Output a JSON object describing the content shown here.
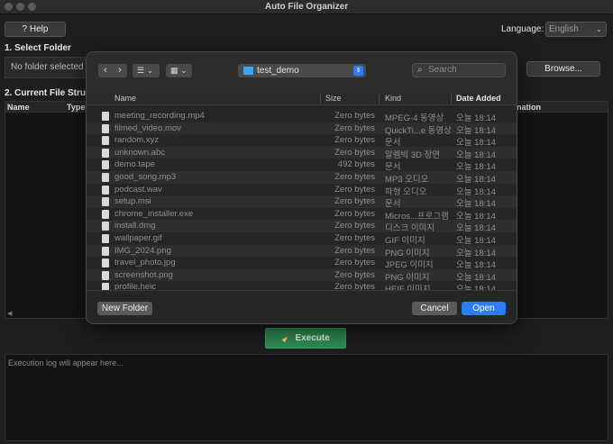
{
  "window": {
    "title": "Auto File Organizer"
  },
  "toolbar": {
    "help_label": "? Help",
    "language_label": "Language:",
    "language_value": "English"
  },
  "section1": {
    "title": "1. Select Folder",
    "folder_placeholder": "No folder selected",
    "browse_label": "Browse..."
  },
  "section2": {
    "title": "2. Current File Structu",
    "columns": [
      "Name",
      "Type",
      "nation"
    ]
  },
  "execute": {
    "label": "Execute"
  },
  "log": {
    "placeholder": "Execution log will appear here..."
  },
  "dialog": {
    "current_folder": "test_demo",
    "search_placeholder": "Search",
    "columns": {
      "name": "Name",
      "size": "Size",
      "kind": "Kind",
      "date": "Date Added"
    },
    "files": [
      {
        "name": "meeting_recording.mp4",
        "size": "Zero bytes",
        "kind": "MPEG-4 동영상",
        "date": "오늘 18:14"
      },
      {
        "name": "filmed_video.mov",
        "size": "Zero bytes",
        "kind": "QuickTi...e 동영상",
        "date": "오늘 18:14"
      },
      {
        "name": "random.xyz",
        "size": "Zero bytes",
        "kind": "문서",
        "date": "오늘 18:14"
      },
      {
        "name": "unknown.abc",
        "size": "Zero bytes",
        "kind": "알렘빅 3D 장면",
        "date": "오늘 18:14"
      },
      {
        "name": "demo.tape",
        "size": "492 bytes",
        "kind": "문서",
        "date": "오늘 18:14"
      },
      {
        "name": "good_song.mp3",
        "size": "Zero bytes",
        "kind": "MP3 오디오",
        "date": "오늘 18:14"
      },
      {
        "name": "podcast.wav",
        "size": "Zero bytes",
        "kind": "파형 오디오",
        "date": "오늘 18:14"
      },
      {
        "name": "setup.msi",
        "size": "Zero bytes",
        "kind": "문서",
        "date": "오늘 18:14"
      },
      {
        "name": "chrome_installer.exe",
        "size": "Zero bytes",
        "kind": "Micros...프로그램",
        "date": "오늘 18:14"
      },
      {
        "name": "install.dmg",
        "size": "Zero bytes",
        "kind": "디스크 이미지",
        "date": "오늘 18:14"
      },
      {
        "name": "wallpaper.gif",
        "size": "Zero bytes",
        "kind": "GIF 이미지",
        "date": "오늘 18:14"
      },
      {
        "name": "IMG_2024.png",
        "size": "Zero bytes",
        "kind": "PNG 이미지",
        "date": "오늘 18:14"
      },
      {
        "name": "travel_photo.jpg",
        "size": "Zero bytes",
        "kind": "JPEG 이미지",
        "date": "오늘 18:14"
      },
      {
        "name": "screenshot.png",
        "size": "Zero bytes",
        "kind": "PNG 이미지",
        "date": "오늘 18:14"
      },
      {
        "name": "profile.heic",
        "size": "Zero bytes",
        "kind": "HEIF 이미지",
        "date": "오늘 18:14"
      }
    ],
    "new_folder_label": "New Folder",
    "cancel_label": "Cancel",
    "open_label": "Open"
  }
}
